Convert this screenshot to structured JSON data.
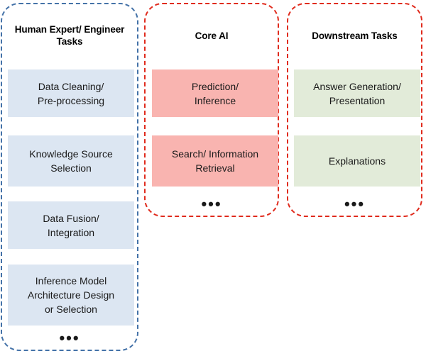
{
  "diagram": {
    "title_semantic": "AI pipeline task responsibility columns",
    "columns": [
      {
        "id": "human-expert",
        "title": "Human Expert/\nEngineer Tasks",
        "border_color": "#4472a8",
        "border_style": "dashed",
        "fill_color": "#dce6f2",
        "ellipsis": "•••",
        "boxes": [
          {
            "label": "Data Cleaning/\nPre-processing"
          },
          {
            "label": "Knowledge Source\nSelection"
          },
          {
            "label": "Data Fusion/\nIntegration"
          },
          {
            "label": "Inference Model\nArchitecture Design\nor Selection"
          }
        ]
      },
      {
        "id": "core-ai",
        "title": "Core AI",
        "border_color": "#e02b1d",
        "border_style": "dashed",
        "fill_color": "#f9b4b0",
        "ellipsis": "•••",
        "boxes": [
          {
            "label": "Prediction/\nInference"
          },
          {
            "label": "Search/ Information\nRetrieval"
          }
        ]
      },
      {
        "id": "downstream",
        "title": "Downstream Tasks",
        "border_color": "#e02b1d",
        "border_style": "dashed",
        "fill_color": "#e2ebd9",
        "ellipsis": "•••",
        "boxes": [
          {
            "label": "Answer Generation/\nPresentation"
          },
          {
            "label": "Explanations"
          }
        ]
      }
    ]
  }
}
